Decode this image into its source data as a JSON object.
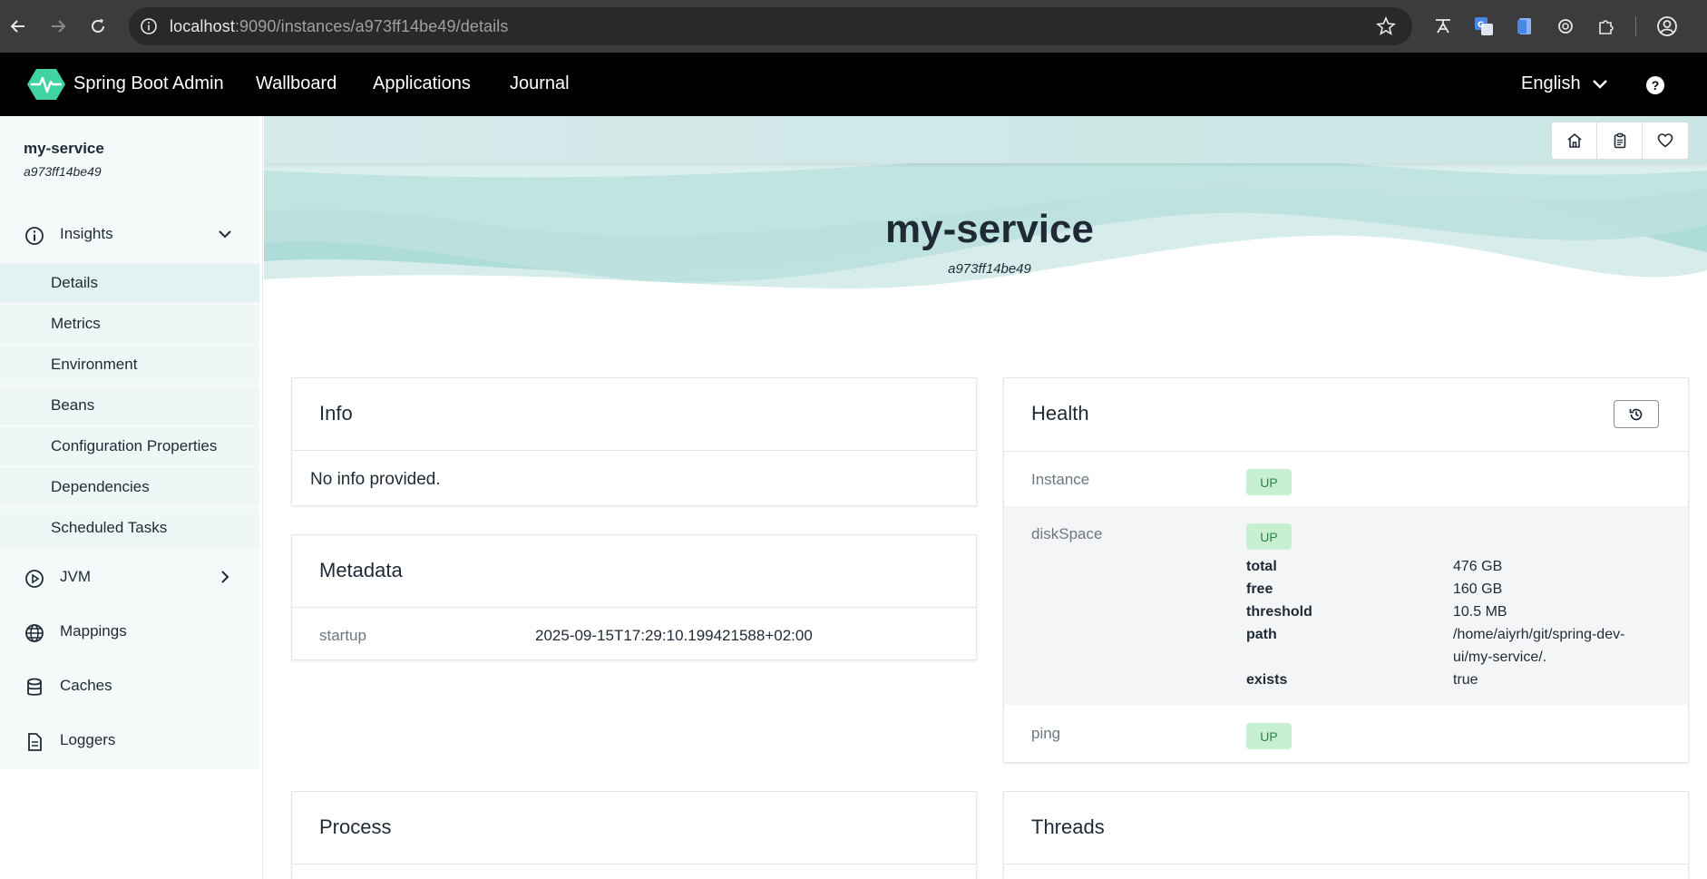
{
  "browser": {
    "url_host": "localhost",
    "url_path": ":9090/instances/a973ff14be49/details"
  },
  "header": {
    "brand": "Spring Boot Admin",
    "nav": [
      "Wallboard",
      "Applications",
      "Journal"
    ],
    "language": "English"
  },
  "sidebar": {
    "app_name": "my-service",
    "app_id": "a973ff14be49",
    "insights_label": "Insights",
    "insights_items": [
      "Details",
      "Metrics",
      "Environment",
      "Beans",
      "Configuration Properties",
      "Dependencies",
      "Scheduled Tasks"
    ],
    "jvm_label": "JVM",
    "mappings_label": "Mappings",
    "caches_label": "Caches",
    "loggers_label": "Loggers"
  },
  "hero": {
    "title": "my-service",
    "subtitle": "a973ff14be49"
  },
  "info": {
    "title": "Info",
    "message": "No info provided."
  },
  "metadata": {
    "title": "Metadata",
    "key": "startup",
    "value": "2025-09-15T17:29:10.199421588+02:00"
  },
  "health": {
    "title": "Health",
    "instance_label": "Instance",
    "instance_status": "UP",
    "disk_label": "diskSpace",
    "disk_status": "UP",
    "disk_details": {
      "total_key": "total",
      "total_val": "476 GB",
      "free_key": "free",
      "free_val": "160 GB",
      "threshold_key": "threshold",
      "threshold_val": "10.5 MB",
      "path_key": "path",
      "path_val_1": "/home/aiyrh/git/spring-dev-",
      "path_val_2": "ui/my-service/.",
      "exists_key": "exists",
      "exists_val": "true"
    },
    "ping_label": "ping",
    "ping_status": "UP"
  },
  "process": {
    "title": "Process"
  },
  "threads": {
    "title": "Threads"
  },
  "colors": {
    "accent": "#42d3a5",
    "header_bg": "#000000",
    "badge_bg": "#c7f0d3",
    "badge_text": "#278446"
  }
}
